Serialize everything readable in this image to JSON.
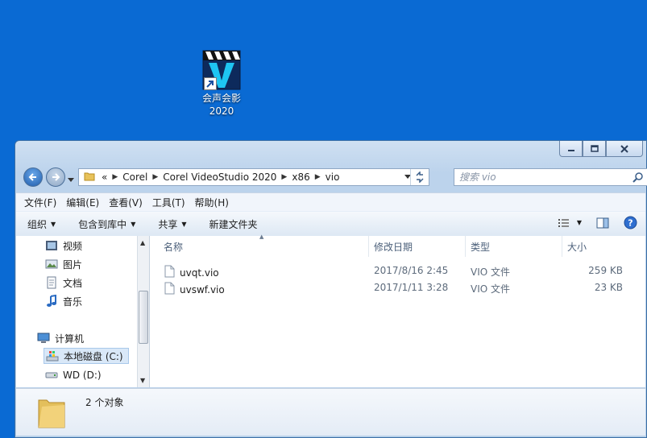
{
  "desktop": {
    "icons": [
      {
        "label_line1": "会声会影",
        "label_line2": "2020",
        "icon": "corel-videostudio-icon"
      }
    ]
  },
  "window": {
    "caption_buttons": [
      "minimize",
      "maximize",
      "close"
    ],
    "address": {
      "overflow": "«",
      "crumbs": [
        "Corel",
        "Corel VideoStudio 2020",
        "x86",
        "vio"
      ]
    },
    "search": {
      "placeholder": "搜索 vio"
    },
    "menu": [
      "文件(F)",
      "编辑(E)",
      "查看(V)",
      "工具(T)",
      "帮助(H)"
    ],
    "toolbar": {
      "organize": "组织",
      "include_in_library": "包含到库中",
      "share": "共享",
      "new_folder": "新建文件夹"
    },
    "nav_pane": {
      "items": [
        {
          "label": "视频",
          "icon": "video-library-icon"
        },
        {
          "label": "图片",
          "icon": "pictures-library-icon"
        },
        {
          "label": "文档",
          "icon": "documents-library-icon"
        },
        {
          "label": "音乐",
          "icon": "music-library-icon"
        },
        {
          "label": "计算机",
          "icon": "computer-icon"
        },
        {
          "label": "本地磁盘 (C:)",
          "icon": "windows-drive-icon"
        },
        {
          "label": "WD (D:)",
          "icon": "drive-icon"
        }
      ]
    },
    "columns": {
      "name": "名称",
      "modified": "修改日期",
      "type": "类型",
      "size": "大小"
    },
    "files": [
      {
        "name": "uvqt.vio",
        "modified": "2017/8/16 2:45",
        "type": "VIO 文件",
        "size": "259 KB"
      },
      {
        "name": "uvswf.vio",
        "modified": "2017/1/11 3:28",
        "type": "VIO 文件",
        "size": "23 KB"
      }
    ],
    "details": {
      "count": "2 个对象"
    }
  },
  "colors": {
    "desktop": "#0a6ad3",
    "selection": "#d9e8f8"
  }
}
